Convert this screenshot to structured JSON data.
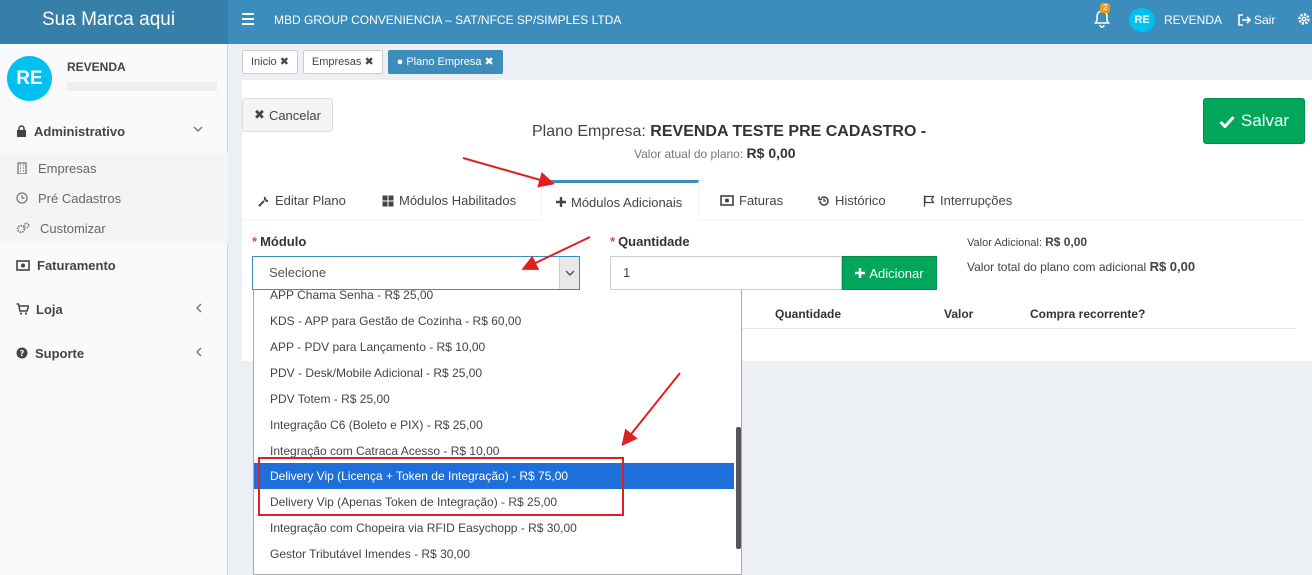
{
  "topbar": {
    "brand": "Sua Marca aqui",
    "company": "MBD GROUP CONVENIENCIA – SAT/NFCE SP/SIMPLES LTDA",
    "notifications_count": "2",
    "avatar_initials": "RE",
    "user": "REVENDA",
    "logout": "Sair"
  },
  "sidebar": {
    "avatar_initials": "RE",
    "user": "REVENDA",
    "sections": [
      {
        "label": "Administrativo"
      },
      {
        "label": "Faturamento"
      },
      {
        "label": "Loja"
      },
      {
        "label": "Suporte"
      }
    ],
    "admin_items": [
      {
        "label": "Empresas"
      },
      {
        "label": "Pré Cadastros"
      },
      {
        "label": "Customizar"
      }
    ]
  },
  "breadcrumbs": [
    {
      "label": "Inicio"
    },
    {
      "label": "Empresas"
    },
    {
      "label": "Plano Empresa"
    }
  ],
  "actions": {
    "cancel": "Cancelar",
    "save": "Salvar"
  },
  "plan": {
    "title_prefix": "Plano Empresa:",
    "title_name": "REVENDA TESTE PRE CADASTRO -",
    "value_label": "Valor atual do plano:",
    "value": "R$ 0,00"
  },
  "tabs": [
    {
      "label": "Editar Plano"
    },
    {
      "label": "Módulos Habilitados"
    },
    {
      "label": "Módulos Adicionais"
    },
    {
      "label": "Faturas"
    },
    {
      "label": "Histórico"
    },
    {
      "label": "Interrupções"
    }
  ],
  "form": {
    "module_label": "Módulo",
    "module_placeholder": "Selecione",
    "qty_label": "Quantidade",
    "qty_value": "1",
    "add_button": "Adicionar",
    "extra_value_label": "Valor Adicional:",
    "extra_value": "R$ 0,00",
    "total_label": "Valor total do plano com adicional",
    "total_value": "R$ 0,00"
  },
  "table_headers": [
    "Quantidade",
    "Valor",
    "Compra recorrente?"
  ],
  "dropdown_options": [
    "APP Chama Senha - R$ 25,00",
    "KDS - APP para Gestão de Cozinha - R$ 60,00",
    "APP - PDV para Lançamento - R$ 10,00",
    "PDV - Desk/Mobile Adicional - R$ 25,00",
    "PDV Totem - R$ 25,00",
    "Integração C6 (Boleto e PIX) - R$ 25,00",
    "Integração com Catraca Acesso - R$ 10,00",
    "Delivery Vip (Licença + Token de Integração) - R$ 75,00",
    "Delivery Vip (Apenas Token de Integração) - R$ 25,00",
    "Integração com Chopeira via RFID Easychopp - R$ 30,00",
    "Gestor Tributável Imendes - R$ 30,00"
  ],
  "dropdown_selected_index": 7,
  "colors": {
    "topbar": "#3c8dbc",
    "brand_bg": "#367fa9",
    "success": "#00a65a",
    "highlight": "#1e6fd9",
    "annotation": "#e02020"
  }
}
